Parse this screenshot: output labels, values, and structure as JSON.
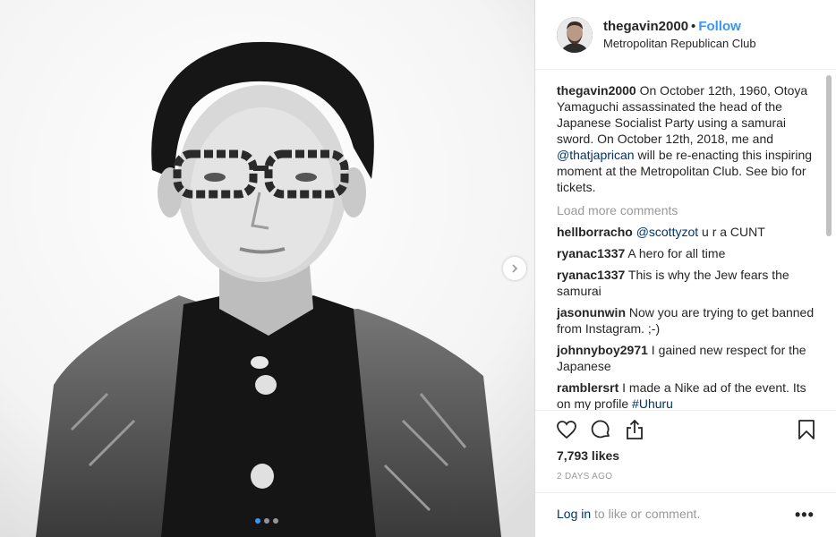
{
  "post": {
    "username": "thegavin2000",
    "separator": "•",
    "follow_label": "Follow",
    "location": "Metropolitan Republican Club",
    "image_icon": "portrait-photo",
    "caption": {
      "username": "thegavin2000",
      "text_part1": " On October 12th, 1960, Otoya Yamaguchi assassinated the head of the Japanese Socialist Party using a samurai sword. On October 12th, 2018, me and ",
      "mention": "@thatjaprican",
      "text_part2": " will be re-enacting this inspiring moment at the Metropolitan Club. See bio for tickets."
    },
    "load_more": "Load more comments",
    "comments": [
      {
        "user": "hellborracho",
        "mention": "@scottyzot",
        "text": " u r a CUNT"
      },
      {
        "user": "ryanac1337",
        "mention": "",
        "text": " A hero for all time"
      },
      {
        "user": "ryanac1337",
        "mention": "",
        "text": " This is why the Jew fears the samurai"
      },
      {
        "user": "jasonunwin",
        "mention": "",
        "text": " Now you are trying to get banned from Instagram. ;-)"
      },
      {
        "user": "johnnyboy2971",
        "mention": "",
        "text": " I gained new respect for the Japanese"
      },
      {
        "user": "ramblersrt",
        "mention": "",
        "text": " I made a Nike ad of the event. Its on my profile ",
        "tag": "#Uhuru"
      }
    ],
    "likes": "7,793 likes",
    "time": "2 DAYS AGO",
    "login_link": "Log in",
    "login_rest": " to like or comment.",
    "more_options": "•••",
    "carousel": {
      "count": 3,
      "active": 0
    }
  },
  "colors": {
    "link": "#3897f0",
    "mention": "#003569",
    "muted": "#999999",
    "text": "#262626",
    "border": "#dbdbdb"
  },
  "icons": [
    "heart-icon",
    "comment-icon",
    "share-icon",
    "bookmark-icon",
    "chevron-right-icon"
  ]
}
